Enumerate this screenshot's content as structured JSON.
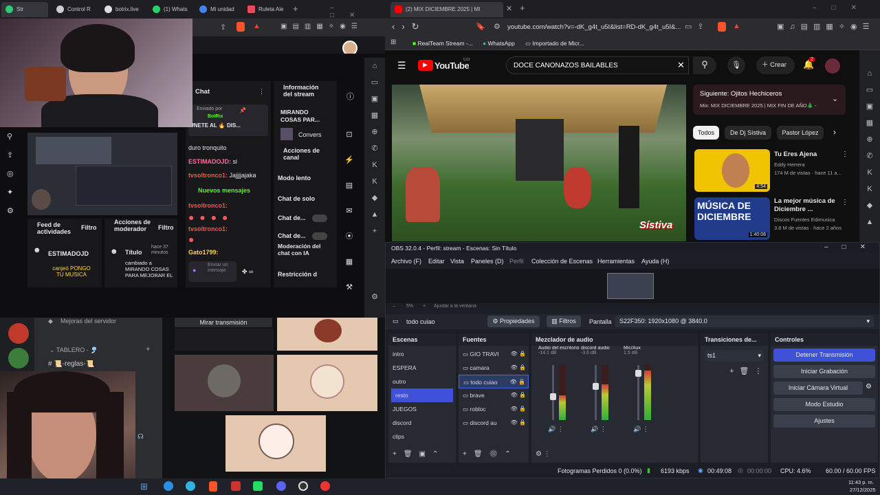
{
  "left_browser": {
    "tabs": [
      {
        "label": "Str",
        "color": "#2ecc71"
      },
      {
        "label": "Control R",
        "color": "#cccccc"
      },
      {
        "label": "botrix.live",
        "color": "#dddddd"
      },
      {
        "label": "(1) Whats",
        "color": "#25d366"
      },
      {
        "label": "Mi unidad",
        "color": "#4285f4"
      },
      {
        "label": "Ruleta Ale",
        "color": "#e84a5f"
      }
    ],
    "new_tab": "+"
  },
  "twitch": {
    "chat_title": "Chat",
    "sent_by": "Enviado por",
    "sent_by_user": "BotRix",
    "pinned_text": "UNETE AL 🔥 DIS...",
    "messages": [
      {
        "user": "",
        "text": "duro tronquito",
        "color": "#e8e8ec"
      },
      {
        "user": "ESTIMADOJD:",
        "text": "si",
        "color": "#ff6b9a"
      },
      {
        "user": "tvsoltronco1:",
        "text": "Jajjjjajaka",
        "color": "#ff4f4f"
      }
    ],
    "new_messages": "Nuevos mensajes",
    "emote_messages": [
      {
        "user": "tvsoltronco1:"
      },
      {
        "user": "tvsoltronco1:"
      },
      {
        "user": "Gato1799:"
      }
    ],
    "send_placeholder": "Enviar un mensaje",
    "stream_info_title": "Información del stream",
    "stream_title": "MIRANDO COSAS PAR...",
    "category": "Convers",
    "channel_actions": "Acciones de canal",
    "menu": [
      "Modo lento",
      "Chat de solo",
      "Chat de...",
      "Chat de..."
    ],
    "moderation": "Moderación del chat con IA",
    "restriction": "Restricción d",
    "feed_title": "Feed de actividades",
    "filter": "Filtro",
    "feed_user": "ESTIMADOJD",
    "feed_action": "canjeó PONGO TU MUSICA",
    "mod_actions_title": "Acciones de moderador",
    "mod_filter": "Filtro",
    "mod_item_title": "Título",
    "mod_item_time": "hace 37 minutos",
    "mod_item_desc": "cambiado a MIRANDO COSAS PARA MEJORAR EL"
  },
  "discord": {
    "server_improvements": "Mejoras del servidor",
    "watch_stream": "Mirar transmisión",
    "category": "TABLERO - 🎐",
    "channel": "📜-reglas-📜"
  },
  "right_browser": {
    "tab_label": "(2) MIX DICIEMBRE 2025 | MI",
    "url": "youtube.com/watch?v=-dK_g4t_u5I&list=RD-dK_g4t_u5I&...",
    "bookmarks": [
      "RealTeam Stream -...",
      "WhatsApp",
      "Importado de Micr..."
    ]
  },
  "youtube": {
    "logo": "YouTube",
    "logo_sup": "CO",
    "search_value": "DOCE CAÑONAZOS BAILABLES",
    "create": "Crear",
    "notif_count": "2",
    "next_label": "Siguiente: Ojitos Hechiceros",
    "mix_label": "Mix: MIX DICIEMBRE 2025 | MIX FIN DE AÑO🎄 -",
    "chips": [
      "Todos",
      "De Dj Sístiva",
      "Pastor López"
    ],
    "videos": [
      {
        "title": "Tu Eres Ajena",
        "channel": "Eddy Herrera",
        "meta": "174 M de vistas · hace 11 a...",
        "duration": "4:54",
        "thumb_text": "",
        "thumb_color": "#f0c400"
      },
      {
        "title": "La mejor música de Diciembre ...",
        "channel": "Discos Fuentes Edimusica",
        "meta": "3.8 M de vistas · hace 2 años",
        "duration": "1:40:08",
        "thumb_text": "MÚSICA DE DICIEMBRE",
        "thumb_color": "#1f3b8a"
      }
    ],
    "watermark": "Sístiva"
  },
  "obs": {
    "title": "OBS 32.0.4 - Perfil: stream - Escenas: Sin Título",
    "menu": [
      "Archivo (F)",
      "Editar",
      "Vista",
      "Paneles (D)",
      "Perfil",
      "Colección de Escenas",
      "Herramientas",
      "Ayuda (H)"
    ],
    "zoom": "5%",
    "fit": "Ajustar a la ventana",
    "source_selected": "todo cuiao",
    "properties": "Propiedades",
    "filters": "Filtros",
    "screen_label": "Pantalla",
    "screen_value": "S22F350: 1920x1080 @ 3840.0",
    "scenes_title": "Escenas",
    "scenes": [
      "intro",
      "ESPERA",
      "outro",
      "resto",
      "JUEGOS",
      "discord",
      "clips"
    ],
    "active_scene": 3,
    "sources_title": "Fuentes",
    "sources": [
      "GIO TRAVI",
      "camara",
      "todo cuiao",
      "brave",
      "robloc",
      "discord au"
    ],
    "mixer_title": "Mezclador de audio",
    "channels": [
      {
        "name": "Audio del escritorio",
        "db": "-14.1 dB",
        "level": 0.45
      },
      {
        "name": "discord audio",
        "db": "-3.6 dB",
        "level": 0.65
      },
      {
        "name": "Mic/Aux",
        "db": "1.5 dB",
        "level": 0.9
      }
    ],
    "transitions_title": "Transiciones de...",
    "transition": "ts1",
    "controls_title": "Controles",
    "controls": [
      "Detener Transmisión",
      "Iniciar Grabación",
      "Iniciar Cámara Virtual",
      "Modo Estudio",
      "Ajustes"
    ],
    "status": {
      "dropped": "Fotogramas Perdidos 0 (0.0%)",
      "bitrate": "6193 kbps",
      "live_time": "00:49:08",
      "rec_time": "00:00:00",
      "cpu": "CPU: 4.6%",
      "fps": "60.00 / 60.00 FPS"
    }
  },
  "taskbar": {
    "time": "11:43 p. m.",
    "date": "27/12/2025"
  }
}
